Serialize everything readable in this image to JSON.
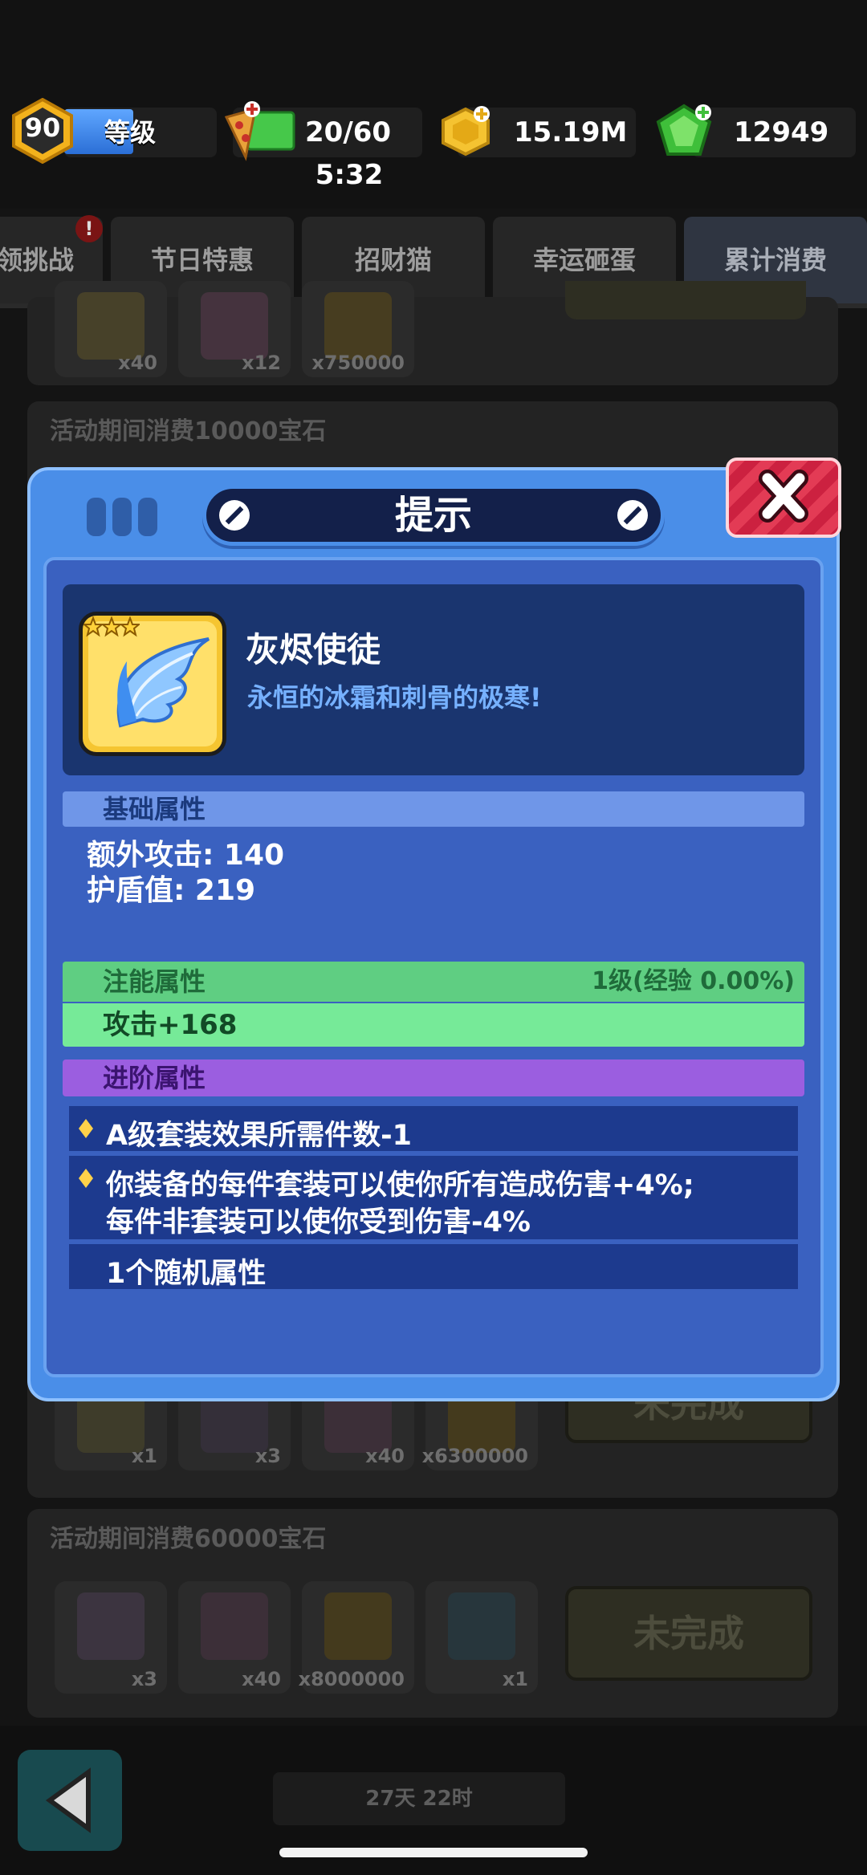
{
  "resources": {
    "level": "90",
    "level_label": "等级",
    "stamina": "20/60",
    "stamina_timer": "5:32",
    "gold": "15.19M",
    "gems": "12949"
  },
  "tabs": [
    {
      "label": "领挑战"
    },
    {
      "label": "节日特惠"
    },
    {
      "label": "招财猫"
    },
    {
      "label": "幸运砸蛋"
    },
    {
      "label": "累计消费"
    }
  ],
  "notify_badge": "!",
  "cards": {
    "top_counts": [
      "x40",
      "x12",
      "x750000"
    ],
    "card2_title": "活动期间消费10000宝石",
    "card2_counts": [
      "x1",
      "x3",
      "x40",
      "x6300000"
    ],
    "card2_button": "未完成",
    "card3_title": "活动期间消费60000宝石",
    "card3_counts": [
      "x3",
      "x40",
      "x8000000",
      "x1"
    ],
    "card3_button": "未完成"
  },
  "dialog": {
    "title": "提示",
    "item_name": "灰烬使徒",
    "item_desc": "永恒的冰霜和刺骨的极寒!",
    "base_header": "基础属性",
    "base_stats": [
      "额外攻击: 140",
      "护盾值: 219"
    ],
    "infuse_header": "注能属性",
    "infuse_level": "1级(经验 0.00%)",
    "infuse_stat": "攻击+168",
    "advanced_header": "进阶属性",
    "advanced_1": "A级套装效果所需件数-1",
    "advanced_2_line1": "你装备的每件套装可以使你所有造成伤害+4%;",
    "advanced_2_line2": "每件非套装可以使你受到伤害-4%",
    "advanced_3": "1个随机属性"
  },
  "footer": {
    "countdown": "27天 22时"
  },
  "colors": {
    "dialog_blue": "#4a8ee8",
    "infuse_green": "#6fe08f",
    "advanced_purple": "#9b5ee0",
    "close_red": "#e33b55"
  }
}
